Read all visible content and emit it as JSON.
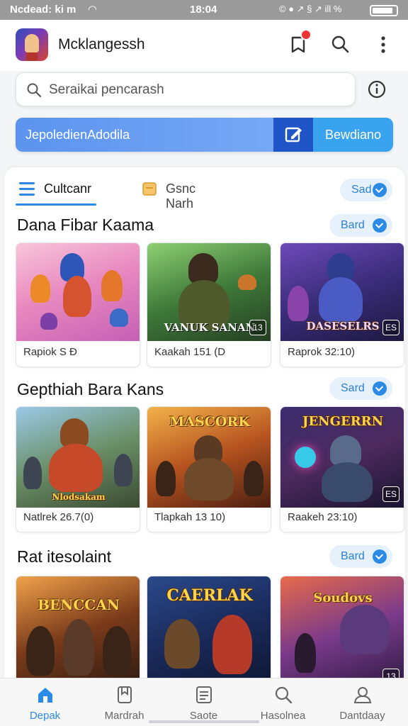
{
  "status_bar": {
    "left_text": "Ncdead: ki m",
    "time": "18:04",
    "right_text": "© ● ↗ § ↗ ill %"
  },
  "header": {
    "app_title": "Mcklangessh",
    "notification_count": ""
  },
  "search": {
    "placeholder": "Seraikai pencarash"
  },
  "promo": {
    "left_label": "JepoledienAdodila",
    "right_label": "Bewdiano"
  },
  "tabs": [
    {
      "label": "Cultcanr",
      "active": true
    },
    {
      "label": "Gsnc Narh",
      "active": false
    }
  ],
  "tab_action_label": "Sad",
  "sections": [
    {
      "title": "Dana Fibar Kaama",
      "action_label": "Bard",
      "games": [
        {
          "art_title": "",
          "meta": "Rapiok S Ð",
          "badge": ""
        },
        {
          "art_title": "VANUK SANAN",
          "meta": "Kaakah 151 (D",
          "badge": "13"
        },
        {
          "art_title": "DASESELRS",
          "meta": "Raprok 32:10)",
          "badge": "ES"
        }
      ]
    },
    {
      "title": "Gepthiah Bara Kans",
      "action_label": "Sard",
      "games": [
        {
          "art_title": "Nlodsakam",
          "meta": "Natlrek 26.7(0)",
          "badge": ""
        },
        {
          "art_title": "MASCORK",
          "meta": "Tlapkah 13 10)",
          "badge": ""
        },
        {
          "art_title": "JENGERRN",
          "meta": "Raakeh 23:10)",
          "badge": "ES"
        }
      ]
    },
    {
      "title": "Rat itesolaint",
      "action_label": "Bard",
      "games": [
        {
          "art_title": "BENCCAN",
          "meta": "",
          "badge": ""
        },
        {
          "art_title": "CAERLAK",
          "meta": "",
          "badge": ""
        },
        {
          "art_title": "Soudovs",
          "meta": "",
          "badge": "13"
        }
      ]
    }
  ],
  "bottom_nav": [
    {
      "label": "Depak",
      "icon": "home-icon",
      "active": true
    },
    {
      "label": "Mardrah",
      "icon": "bookmark-icon",
      "active": false
    },
    {
      "label": "Saote",
      "icon": "document-icon",
      "active": false
    },
    {
      "label": "Hasolnea",
      "icon": "search-icon",
      "active": false
    },
    {
      "label": "Dantdaay",
      "icon": "profile-icon",
      "active": false
    }
  ],
  "colors": {
    "accent": "#2b8ae6",
    "promo_dark": "#1f55c7",
    "promo_light": "#3aa3f0",
    "notification": "#e33333"
  }
}
